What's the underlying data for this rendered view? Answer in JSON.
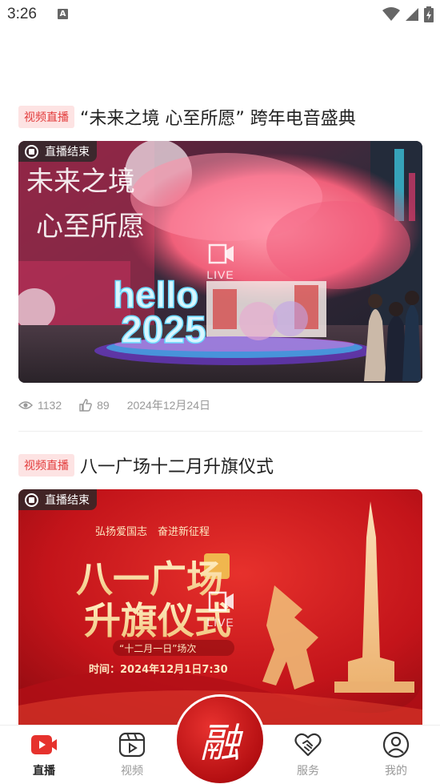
{
  "status_bar": {
    "time": "3:26",
    "notification_glyph": "A"
  },
  "cards": [
    {
      "tag": "视频直播",
      "title": "“未来之境 心至所愿” 跨年电音盛典",
      "badge": "直播结束",
      "center_label": "LIVE",
      "image_text": {
        "neon_line1": "hello",
        "neon_line2": "2025",
        "banner_line1": "未来之境",
        "banner_line2": "心至所愿"
      },
      "views": "1132",
      "likes": "89",
      "date": "2024年12月24日"
    },
    {
      "tag": "视频直播",
      "title": "八一广场十二月升旗仪式",
      "badge": "直播结束",
      "center_label": "LIVE",
      "image_text": {
        "slogan": "弘扬爱国志　奋进新征程",
        "headline1": "八一广场",
        "headline2": "升旗仪式",
        "session": "“十二月一日”场次",
        "time": "时间：2024年12月1日7:30"
      }
    }
  ],
  "tabbar": {
    "tabs": [
      {
        "label": "直播",
        "icon": "live-video-icon",
        "active": true
      },
      {
        "label": "视频",
        "icon": "video-play-icon",
        "active": false
      },
      {
        "label": "",
        "icon": "rong-logo-icon",
        "active": false
      },
      {
        "label": "服务",
        "icon": "handshake-heart-icon",
        "active": false
      },
      {
        "label": "我的",
        "icon": "user-profile-icon",
        "active": false
      }
    ],
    "center_glyph": "融"
  },
  "colors": {
    "accent": "#e23b3b",
    "tag_bg": "#fde3e3",
    "muted": "#999999"
  }
}
